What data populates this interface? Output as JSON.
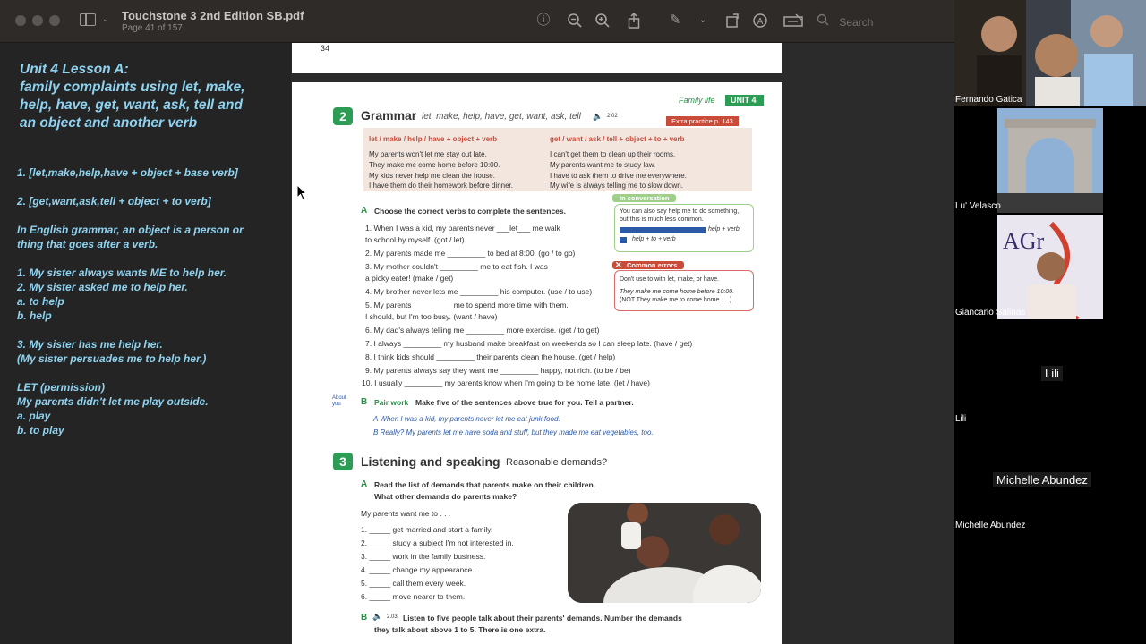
{
  "window": {
    "title": "Touchstone 3 2nd Edition SB.pdf",
    "subtitle": "Page 41 of 157",
    "search_placeholder": "Search"
  },
  "toolbar_icons": [
    "info-icon",
    "zoom-out-icon",
    "zoom-in-icon",
    "share-icon",
    "markup-icon",
    "chevron-down-icon",
    "rotate-icon",
    "navigate-icon",
    "form-icon"
  ],
  "notes": {
    "heading_lines": [
      "Unit 4 Lesson A:",
      "family complaints using let, make,",
      "help, have, get, want, ask, tell and",
      "an object and another verb"
    ],
    "lines": [
      "1. [let,make,help,have + object + base verb]",
      "2. [get,want,ask,tell + object + to verb]",
      "In English grammar, an object is a person or",
      "thing that goes after a verb.",
      "1. My sister always wants ME to help her.",
      "2. My sister asked me to help her.",
      "a. to help",
      "b. help",
      "3. My sister has me help her.",
      "(My sister persuades me to help her.)",
      "LET (permission)",
      "My parents didn't let me play outside.",
      "a. play",
      "b. to play"
    ]
  },
  "pdf": {
    "page_number": "34",
    "header_tag": "Family life",
    "header_unit": "UNIT 4",
    "grammar": {
      "num": "2",
      "title": "Grammar",
      "subtitle": "let, make, help, have, get, want, ask, tell",
      "audio": "2.02",
      "extra_practice": "Extra practice p. 143",
      "col1_head": "let / make / help / have + object + verb",
      "col1": [
        "My parents won't let me stay out late.",
        "They make me come home before 10:00.",
        "My kids never help me clean the house.",
        "I have them do their homework before dinner."
      ],
      "col2_head": "get / want / ask / tell + object + to + verb",
      "col2": [
        "I can't get them to clean up their rooms.",
        "My parents want me to study law.",
        "I have to ask them to drive me everywhere.",
        "My wife is always telling me to slow down."
      ]
    },
    "conversation": {
      "title": "In conversation",
      "text1": "You can also say help me to do something,",
      "text2": "but this is much less common.",
      "bar1": "help + verb",
      "bar2": "help + to + verb"
    },
    "errors": {
      "title": "Common errors",
      "text1": "Don't use to with let, make, or have.",
      "text2": "They make me come home before 10:00.",
      "text3": "(NOT They make me to come home . . .)"
    },
    "exA": {
      "letter": "A",
      "instruction": "Choose the correct verbs to complete the sentences.",
      "items": [
        "1.  When I was a kid, my parents never ___let___ me walk",
        "     to school by myself. (got / let)",
        "2.  My parents made me _________ to bed at 8:00. (go / to go)",
        "3.  My mother couldn't _________ me to eat fish. I was",
        "     a picky eater! (make / get)",
        "4.  My brother never lets me _________ his computer. (use / to use)",
        "5.  My parents _________ me to spend more time with them.",
        "     I should, but I'm too busy. (want / have)",
        "6.  My dad's always telling me _________ more exercise. (get / to get)",
        "7.  I always _________ my husband make breakfast on weekends so I can sleep late. (have / get)",
        "8.  I think kids should _________ their parents clean the house. (get / help)",
        "9.  My parents always say they want me _________ happy, not rich. (to be / be)",
        "10.  I usually _________ my parents know when I'm going to be home late. (let / have)"
      ]
    },
    "exB": {
      "about": "About you",
      "letter": "B",
      "label": "Pair work",
      "instruction": "Make five of the sentences above true for you. Tell a partner.",
      "a": "A  When I was a kid, my parents never let me eat junk food.",
      "b": "B  Really? My parents let me have soda and stuff, but they made me eat vegetables, too."
    },
    "listening": {
      "num": "3",
      "title": "Listening and speaking",
      "subtitle": "Reasonable demands?",
      "a_letter": "A",
      "a_line1": "Read the list of demands that parents make on their children.",
      "a_line2": "What other demands do parents make?",
      "lead": "My parents want me to . . .",
      "items": [
        "1.   _____ get married and start a family.",
        "2.   _____ study a subject I'm not interested in.",
        "3.   _____ work in the family business.",
        "4.   _____ change my appearance.",
        "5.   _____ call them every week.",
        "6.   _____ move nearer to them."
      ],
      "b_letter": "B",
      "b_audio": "2.03",
      "b_line1": "Listen to five people talk about their parents' demands. Number the demands",
      "b_line2": "they talk about above 1 to 5. There is one extra."
    }
  },
  "participants": [
    {
      "name": "Fernando Gatica"
    },
    {
      "name": "Lu' Velasco"
    },
    {
      "name": "Giancarlo Salinas"
    },
    {
      "name": "Lili",
      "big": "Lili"
    },
    {
      "name": "Michelle Abundez",
      "big": "Michelle Abundez"
    }
  ]
}
